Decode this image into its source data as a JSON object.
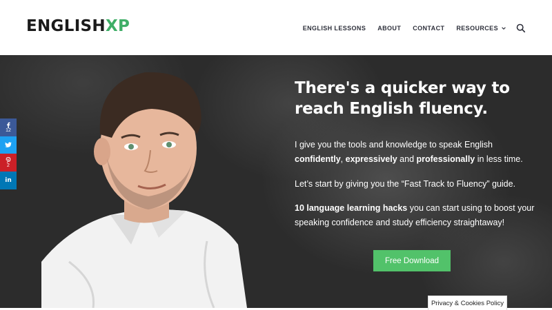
{
  "header": {
    "logo": {
      "part1": "ENGLISH",
      "part2": "XP"
    },
    "nav": {
      "english_lessons": "ENGLISH LESSONS",
      "about": "ABOUT",
      "contact": "CONTACT",
      "resources": "RESOURCES"
    },
    "icons": {
      "resources_dropdown": "chevron-down-icon",
      "search": "search-icon"
    }
  },
  "hero": {
    "headline": "There's a quicker way to reach English fluency.",
    "p1": {
      "a": "I give you the tools and knowledge to speak English ",
      "b": "confidently",
      "c": ", ",
      "d": "expressively",
      "e": " and ",
      "f": "professionally",
      "g": " in less time."
    },
    "p2": "Let’s start by giving you the “Fast Track to Fluency” guide.",
    "p3": {
      "a": "10 language learning hacks",
      "b": " you can start using to boost your speaking confidence and study efficiency straightaway!"
    },
    "cta_label": "Free Download"
  },
  "social": {
    "facebook": {
      "icon": "facebook-icon",
      "count": "12"
    },
    "twitter": {
      "icon": "twitter-icon"
    },
    "pinterest": {
      "icon": "pinterest-icon",
      "count": "2"
    },
    "linkedin": {
      "icon": "linkedin-icon",
      "label": "in"
    }
  },
  "cookie_label": "Privacy & Cookies Policy",
  "colors": {
    "brand_accent": "#3fae67",
    "cta": "#52c26a",
    "facebook": "#3b5998",
    "twitter": "#1da1f2",
    "pinterest": "#cb2027",
    "linkedin": "#0077b5"
  }
}
